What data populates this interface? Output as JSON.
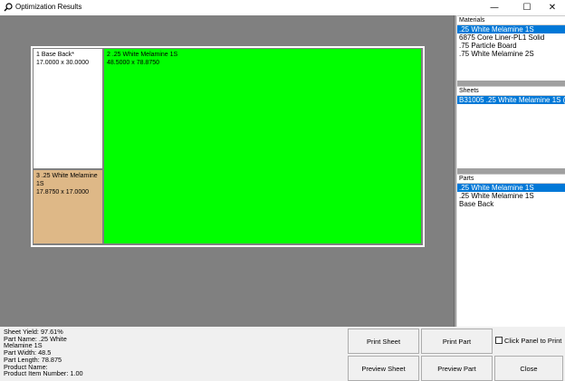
{
  "window": {
    "title": "Optimization Results",
    "controls": {
      "minimize": "—",
      "maximize": "☐",
      "close": "✕"
    }
  },
  "layout_parts": [
    {
      "line1": "1 Base Back*",
      "line2": "",
      "dims": "17.0000 x 30.0000",
      "color": "#ffffff"
    },
    {
      "line1": "2 .25 White Melamine 1S",
      "line2": "",
      "dims": "48.5000 x 78.8750",
      "color": "#00ff00"
    },
    {
      "line1": "3 .25 White Melamine",
      "line2": "1S",
      "dims": "17.8750 x 17.0000",
      "color": "#deb887"
    }
  ],
  "materials": {
    "header": "Materials",
    "items": [
      {
        "label": ".25 White Melamine 1S",
        "selected": true
      },
      {
        "label": "6875 Core Liner-PL1 Solid",
        "selected": false
      },
      {
        "label": ".75 Particle Board",
        "selected": false
      },
      {
        "label": ".75 White Melamine 2S",
        "selected": false
      }
    ]
  },
  "sheets": {
    "header": "Sheets",
    "items": [
      {
        "label": "B31005 .25 White Melamine 1S (4",
        "selected": true
      }
    ]
  },
  "parts": {
    "header": "Parts",
    "items": [
      {
        "label": ".25 White Melamine 1S",
        "selected": true
      },
      {
        "label": ".25 White Melamine 1S",
        "selected": false
      },
      {
        "label": "Base Back",
        "selected": false
      }
    ]
  },
  "status": {
    "sheet_yield": "Sheet Yield:  97.61%",
    "part_name_1": "Part Name:  .25 White",
    "part_name_2": "Melamine 1S",
    "part_width": "Part Width:  48.5",
    "part_length": "Part Length:  78.875",
    "product_name": "Product Name:",
    "product_item_number": "Product Item Number:  1.00"
  },
  "buttons": {
    "print_sheet": "Print Sheet",
    "print_part": "Print Part",
    "preview_sheet": "Preview Sheet",
    "preview_part": "Preview Part",
    "close": "Close",
    "click_panel_to_print": "Click Panel to Print"
  },
  "colors": {
    "canvas": "#808080",
    "selection": "#0078d7"
  }
}
